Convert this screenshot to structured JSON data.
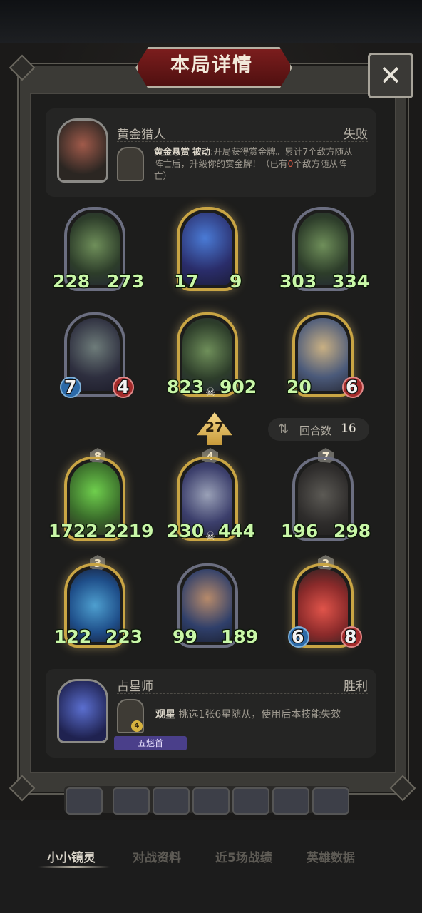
{
  "dialog": {
    "title": "本局详情",
    "close_icon": "close-icon"
  },
  "opponent": {
    "name": "黄金猎人",
    "result": "失败",
    "skill_name": "黄金悬赏",
    "skill_type": "被动",
    "skill_desc_a": ":开局获得赏金牌。累计7个敌方随从",
    "skill_desc_b": "阵亡后，升级你的赏金牌！（已有",
    "skill_count": "0",
    "skill_desc_c": "个敌方随从阵",
    "skill_desc_d": "亡）"
  },
  "enemy_board": [
    {
      "atk": "228",
      "hp": "273",
      "art": "ghost"
    },
    {
      "atk": "17",
      "hp": "9",
      "art": "fairy"
    },
    {
      "atk": "303",
      "hp": "334",
      "art": "ghost"
    },
    {
      "atk": "7",
      "hp": "4",
      "art": "witch"
    },
    {
      "atk": "823",
      "hp": "902",
      "art": "ghost"
    },
    {
      "atk": "20",
      "hp": "6",
      "art": "king"
    }
  ],
  "damage": "27",
  "round": {
    "label": "回合数",
    "value": "16"
  },
  "player_board": [
    {
      "star": "8",
      "atk": "1722",
      "hp": "2219",
      "art": "leaf"
    },
    {
      "star": "4",
      "atk": "230",
      "hp": "444",
      "art": "wizard"
    },
    {
      "star": "7",
      "atk": "196",
      "hp": "298",
      "art": "knight"
    },
    {
      "star": "3",
      "atk": "122",
      "hp": "223",
      "art": "goblin"
    },
    {
      "atk": "99",
      "hp": "189",
      "art": "hero"
    },
    {
      "star": "2",
      "atk": "6",
      "hp": "8",
      "art": "blob"
    }
  ],
  "player": {
    "name": "占星师",
    "result": "胜利",
    "skill_name": "观星",
    "skill_desc": "挑选1张6星随从，使用后本技能失效",
    "skill_level": "4",
    "rank": "五魁首"
  },
  "nav": [
    "小小镜灵",
    "对战资料",
    "近5场战绩",
    "英雄数据"
  ],
  "colors": {
    "accent": "#7b1d1d",
    "stat_green": "#c9f7a8",
    "gold_border": "#c9a544"
  }
}
